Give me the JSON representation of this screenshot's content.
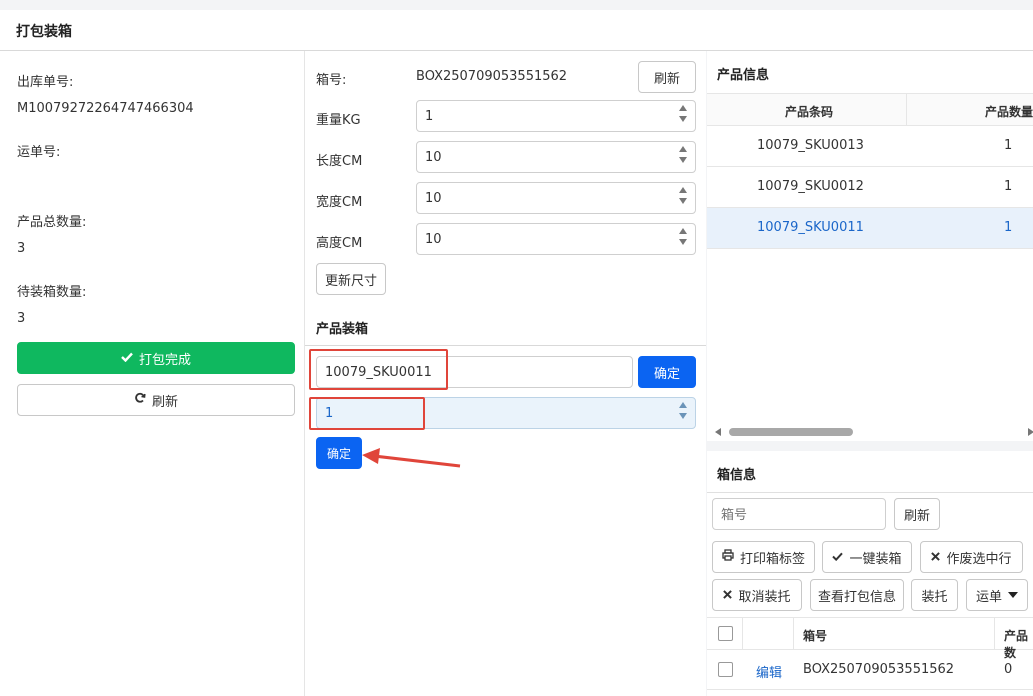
{
  "page": {
    "title": "打包装箱"
  },
  "left": {
    "outbound_no_label": "出库单号:",
    "outbound_no_value": "M10079272264747466304",
    "waybill_label": "运单号:",
    "waybill_value": "",
    "total_qty_label": "产品总数量:",
    "total_qty_value": "3",
    "pending_qty_label": "待装箱数量:",
    "pending_qty_value": "3",
    "complete_button": "打包完成",
    "refresh_button": "刷新"
  },
  "box": {
    "box_no_label": "箱号:",
    "box_no_value": "BOX250709053551562",
    "refresh_button": "刷新",
    "weight_label": "重量KG",
    "weight_value": "1",
    "length_label": "长度CM",
    "length_value": "10",
    "width_label": "宽度CM",
    "width_value": "10",
    "height_label": "高度CM",
    "height_value": "10",
    "update_size_button": "更新尺寸"
  },
  "packing": {
    "title": "产品装箱",
    "barcode_value": "10079_SKU0011",
    "confirm_button_1": "确定",
    "qty_value": "1",
    "confirm_button_2": "确定"
  },
  "product_info": {
    "title": "产品信息",
    "col_barcode": "产品条码",
    "col_qty": "产品数量",
    "rows": [
      {
        "barcode": "10079_SKU0013",
        "qty": "1"
      },
      {
        "barcode": "10079_SKU0012",
        "qty": "1"
      },
      {
        "barcode": "10079_SKU0011",
        "qty": "1"
      }
    ]
  },
  "box_info": {
    "title": "箱信息",
    "search_placeholder": "箱号",
    "refresh_button": "刷新",
    "print_label_button": "打印箱标签",
    "one_click_pack_button": "一键装箱",
    "void_selected_button": "作废选中行",
    "cancel_pallet_button": "取消装托",
    "view_pack_info_button": "查看打包信息",
    "pallet_button": "装托",
    "waybill_dropdown": "运单",
    "col_box_no": "箱号",
    "col_product_qty": "产品数",
    "rows": [
      {
        "action": "编辑",
        "box_no": "BOX250709053551562",
        "qty": "0"
      }
    ]
  },
  "colors": {
    "green": "#0fb85f",
    "blue": "#0b64f2",
    "highlight_red": "#e0453a",
    "selected_row": "#e8f1fb",
    "link": "#1a66c9"
  }
}
